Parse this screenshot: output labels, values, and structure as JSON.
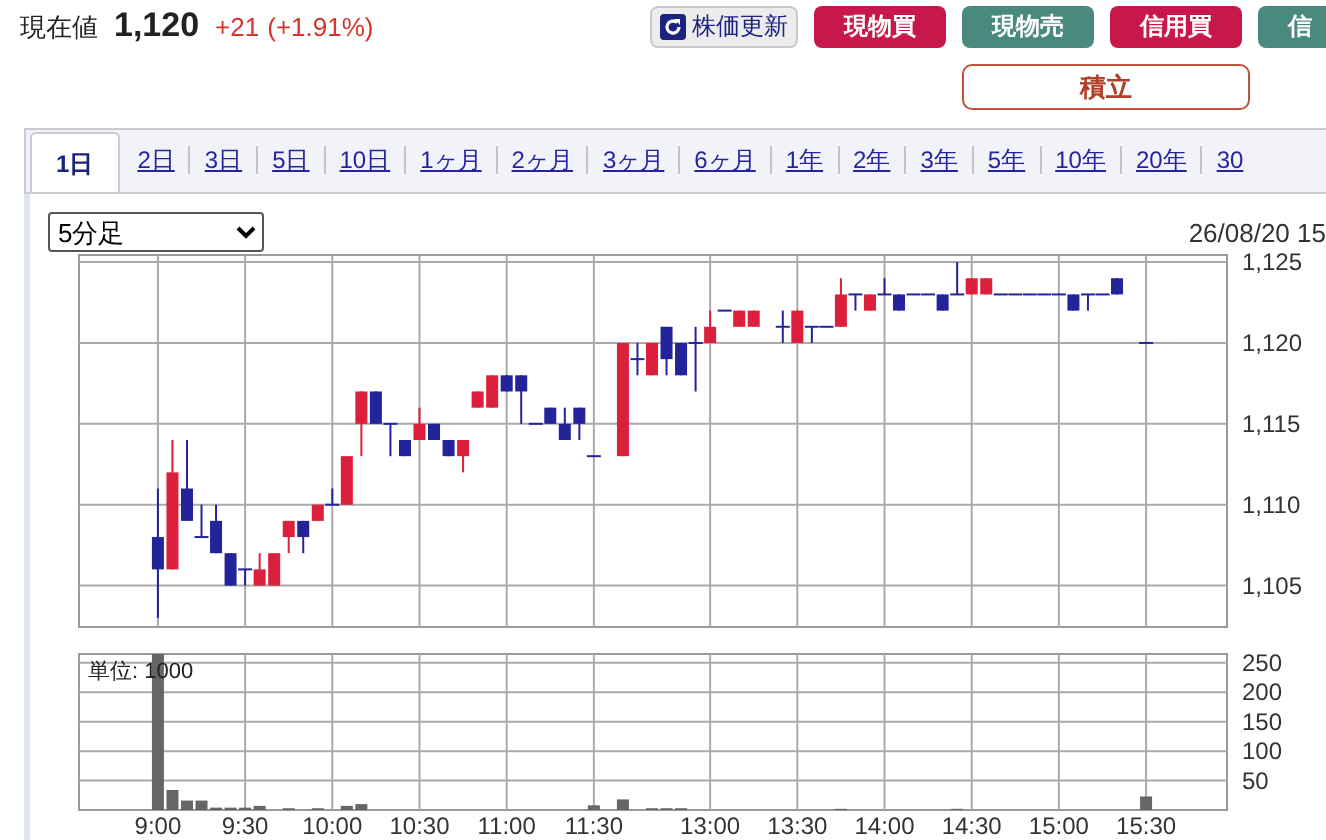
{
  "quote": {
    "label": "現在値",
    "price": "1,120",
    "change": "+21",
    "change_pct": "(+1.91%)"
  },
  "actions": [
    {
      "label": "株価更新",
      "kind": "refresh"
    },
    {
      "label": "現物買",
      "kind": "buy"
    },
    {
      "label": "現物売",
      "kind": "sell"
    },
    {
      "label": "信用買",
      "kind": "buy"
    },
    {
      "label": "信",
      "kind": "sell"
    }
  ],
  "accumulate_button": "積立",
  "period_tabs": [
    {
      "label": "1日",
      "selected": true
    },
    {
      "label": "2日",
      "selected": false
    },
    {
      "label": "3日",
      "selected": false
    },
    {
      "label": "5日",
      "selected": false
    },
    {
      "label": "10日",
      "selected": false
    },
    {
      "label": "1ヶ月",
      "selected": false
    },
    {
      "label": "2ヶ月",
      "selected": false
    },
    {
      "label": "3ヶ月",
      "selected": false
    },
    {
      "label": "6ヶ月",
      "selected": false
    },
    {
      "label": "1年",
      "selected": false
    },
    {
      "label": "2年",
      "selected": false
    },
    {
      "label": "3年",
      "selected": false
    },
    {
      "label": "5年",
      "selected": false
    },
    {
      "label": "10年",
      "selected": false
    },
    {
      "label": "20年",
      "selected": false
    },
    {
      "label": "30",
      "selected": false
    }
  ],
  "interval_select": {
    "value": "5分足"
  },
  "timestamp": "26/08/20 15",
  "price_chart": {
    "chart_data": {
      "type": "candlestick",
      "grid": true,
      "categories": [
        null,
        null,
        null,
        null,
        null,
        null,
        null,
        null,
        null,
        null,
        null,
        null,
        null,
        null,
        null,
        null,
        null,
        null,
        null,
        null,
        null,
        null,
        null,
        null,
        null,
        null,
        null,
        null,
        null,
        null,
        null,
        null,
        null,
        null,
        null,
        null,
        null,
        null,
        null,
        null,
        null,
        null,
        null,
        null,
        null,
        null,
        null,
        null,
        null,
        null,
        null,
        null,
        null,
        null,
        null,
        null,
        null,
        null,
        null,
        null,
        null,
        null,
        null,
        null,
        null,
        null,
        null,
        null,
        null,
        null,
        null,
        null,
        null,
        null,
        null,
        null,
        null,
        null,
        null
      ],
      "ohlc": [
        null,
        null,
        null,
        null,
        null,
        [
          1108,
          1111,
          1103,
          1106
        ],
        [
          1106,
          1114,
          1106,
          1112
        ],
        [
          1111,
          1114,
          1109,
          1109
        ],
        [
          1108,
          1110,
          1108,
          1108
        ],
        [
          1109,
          1110,
          1107,
          1107
        ],
        [
          1107,
          1107,
          1105,
          1105
        ],
        [
          1106,
          1106,
          1105,
          1106
        ],
        [
          1105,
          1107,
          1105,
          1106
        ],
        [
          1105,
          1107,
          1105,
          1107
        ],
        [
          1108,
          1109,
          1107,
          1109
        ],
        [
          1109,
          1109,
          1107,
          1108
        ],
        [
          1109,
          1110,
          1109,
          1110
        ],
        [
          1110,
          1111,
          1110,
          1110
        ],
        [
          1110,
          1113,
          1110,
          1113
        ],
        [
          1115,
          1117,
          1113,
          1117
        ],
        [
          1117,
          1117,
          1115,
          1115
        ],
        [
          1115,
          1115,
          1113,
          1115
        ],
        [
          1114,
          1114,
          1113,
          1113
        ],
        [
          1114,
          1116,
          1114,
          1115
        ],
        [
          1115,
          1115,
          1114,
          1114
        ],
        [
          1114,
          1114,
          1113,
          1113
        ],
        [
          1113,
          1114,
          1112,
          1114
        ],
        [
          1116,
          1117,
          1116,
          1117
        ],
        [
          1116,
          1118,
          1116,
          1118
        ],
        [
          1118,
          1118,
          1117,
          1117
        ],
        [
          1118,
          1118,
          1115,
          1117
        ],
        [
          1115,
          1115,
          1115,
          1115
        ],
        [
          1116,
          1116,
          1115,
          1115
        ],
        [
          1115,
          1116,
          1114,
          1114
        ],
        [
          1116,
          1116,
          1114,
          1115
        ],
        [
          1113,
          1113,
          1113,
          1113
        ],
        null,
        [
          1113,
          1120,
          1113,
          1120
        ],
        [
          1119,
          1120,
          1118,
          1119
        ],
        [
          1118,
          1120,
          1118,
          1120
        ],
        [
          1121,
          1121,
          1118,
          1119
        ],
        [
          1120,
          1120,
          1118,
          1118
        ],
        [
          1120,
          1121,
          1117,
          1120
        ],
        [
          1120,
          1122,
          1120,
          1121
        ],
        [
          1122,
          1122,
          1122,
          1122
        ],
        [
          1121,
          1122,
          1121,
          1122
        ],
        [
          1121,
          1122,
          1121,
          1122
        ],
        null,
        [
          1121,
          1122,
          1120,
          1121
        ],
        [
          1120,
          1122,
          1120,
          1122
        ],
        [
          1121,
          1121,
          1120,
          1121
        ],
        [
          1121,
          1121,
          1121,
          1121
        ],
        [
          1121,
          1124,
          1121,
          1123
        ],
        [
          1123,
          1123,
          1122,
          1123
        ],
        [
          1122,
          1123,
          1122,
          1123
        ],
        [
          1123,
          1124,
          1123,
          1123
        ],
        [
          1123,
          1123,
          1122,
          1122
        ],
        [
          1123,
          1123,
          1123,
          1123
        ],
        [
          1123,
          1123,
          1123,
          1123
        ],
        [
          1123,
          1123,
          1122,
          1122
        ],
        [
          1123,
          1125,
          1123,
          1123
        ],
        [
          1123,
          1124,
          1123,
          1124
        ],
        [
          1123,
          1124,
          1123,
          1124
        ],
        [
          1123,
          1123,
          1123,
          1123
        ],
        [
          1123,
          1123,
          1123,
          1123
        ],
        [
          1123,
          1123,
          1123,
          1123
        ],
        [
          1123,
          1123,
          1123,
          1123
        ],
        [
          1123,
          1123,
          1123,
          1123
        ],
        [
          1123,
          1123,
          1122,
          1122
        ],
        [
          1123,
          1123,
          1122,
          1123
        ],
        [
          1123,
          1123,
          1123,
          1123
        ],
        [
          1124,
          1124,
          1123,
          1123
        ],
        null,
        [
          1120,
          1120,
          1120,
          1120
        ],
        null,
        null,
        null,
        null,
        null
      ],
      "ylim": [
        1102.5,
        1125.5
      ],
      "yticks": [
        {
          "value": 1125,
          "label": "1,125"
        },
        {
          "value": 1120,
          "label": "1,120"
        },
        {
          "value": 1115,
          "label": "1,115"
        },
        {
          "value": 1110,
          "label": "1,110"
        },
        {
          "value": 1105,
          "label": "1,105"
        }
      ]
    }
  },
  "volume_chart": {
    "unit_label": "単位: 1000",
    "chart_data": {
      "type": "bar",
      "grid": true,
      "categories": [
        null,
        null,
        null,
        null,
        null,
        "9:00",
        null,
        null,
        null,
        null,
        null,
        "9:30",
        null,
        null,
        null,
        null,
        null,
        "10:00",
        null,
        null,
        null,
        null,
        null,
        "10:30",
        null,
        null,
        null,
        null,
        null,
        "11:00",
        null,
        null,
        null,
        null,
        null,
        "11:30",
        null,
        null,
        null,
        null,
        null,
        null,
        null,
        "13:00",
        null,
        null,
        null,
        null,
        null,
        "13:30",
        null,
        null,
        null,
        null,
        null,
        "14:00",
        null,
        null,
        null,
        null,
        null,
        "14:30",
        null,
        null,
        null,
        null,
        null,
        "15:00",
        null,
        null,
        null,
        null,
        null,
        "15:30",
        null,
        null,
        null,
        null,
        null
      ],
      "values": [
        null,
        null,
        null,
        null,
        null,
        265,
        34,
        16,
        16,
        4,
        4,
        4,
        7,
        null,
        3,
        null,
        3,
        null,
        7,
        10,
        null,
        null,
        null,
        null,
        null,
        null,
        null,
        null,
        null,
        null,
        null,
        null,
        null,
        null,
        null,
        8,
        null,
        18,
        null,
        3,
        3,
        3,
        null,
        null,
        null,
        null,
        null,
        null,
        null,
        null,
        null,
        null,
        2,
        null,
        null,
        null,
        null,
        null,
        null,
        null,
        2,
        null,
        null,
        null,
        null,
        null,
        null,
        null,
        null,
        null,
        null,
        null,
        null,
        23,
        null,
        null,
        null,
        null,
        null
      ],
      "ylim": [
        0,
        265
      ],
      "yticks": [
        {
          "value": 250,
          "label": "250"
        },
        {
          "value": 200,
          "label": "200"
        },
        {
          "value": 150,
          "label": "150"
        },
        {
          "value": 100,
          "label": "100"
        },
        {
          "value": 50,
          "label": "50"
        }
      ]
    }
  }
}
